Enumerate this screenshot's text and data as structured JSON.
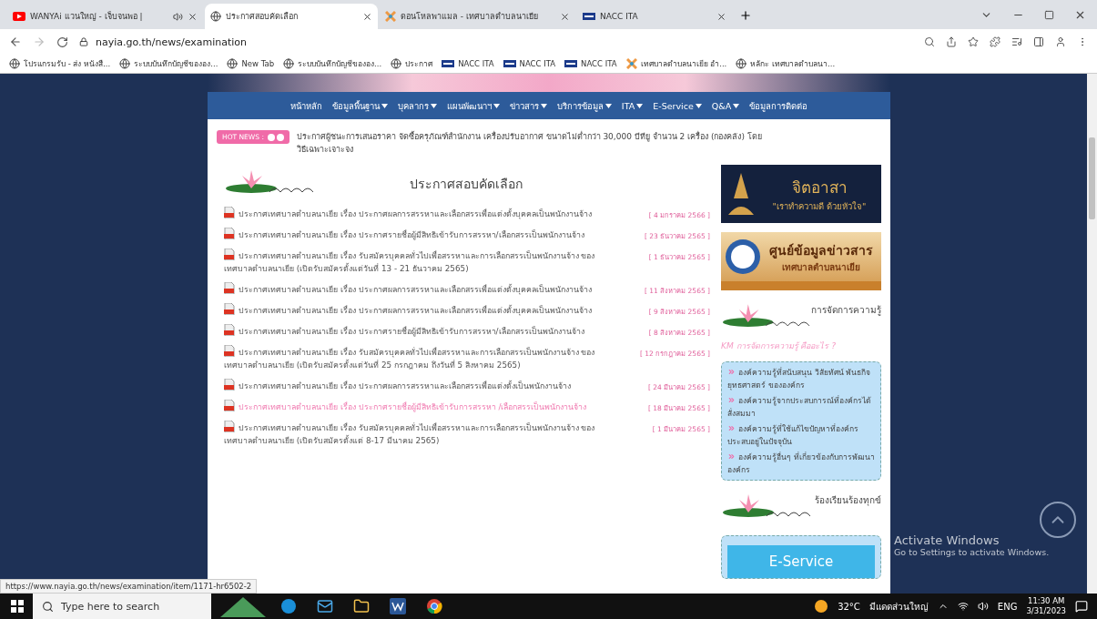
{
  "browser": {
    "tabs": [
      {
        "title": "WANYAi แวนใหญ่ - เจ็บจนพอ |",
        "selected": false,
        "audio": true,
        "kind": "video"
      },
      {
        "title": "ประกาศสอบคัดเลือก",
        "selected": true,
        "audio": false,
        "kind": "globe"
      },
      {
        "title": "ดอนโหลพาแมล - เทศบาลตำบลนาเยีย",
        "selected": false,
        "audio": false,
        "kind": "flag"
      },
      {
        "title": "NACC ITA",
        "selected": false,
        "audio": false,
        "kind": "ita"
      }
    ],
    "address": "nayia.go.th/news/examination",
    "bookmarks": [
      {
        "label": "โปรแกรมรับ - ส่ง หนังสื...",
        "kind": "globe"
      },
      {
        "label": "ระบบบันทึกบัญชีขององ...",
        "kind": "globe"
      },
      {
        "label": "New Tab",
        "kind": "globe"
      },
      {
        "label": "ระบบบันทึกบัญชีขององ...",
        "kind": "globe"
      },
      {
        "label": "ประกาศ",
        "kind": "globe"
      },
      {
        "label": "NACC ITA",
        "kind": "ita"
      },
      {
        "label": "NACC ITA",
        "kind": "ita"
      },
      {
        "label": "NACC ITA",
        "kind": "ita"
      },
      {
        "label": "เทศบาลตำบลนาเยีย อำ...",
        "kind": "flag"
      },
      {
        "label": "หลักะ เทศบาลตำบลนา...",
        "kind": "globe"
      }
    ]
  },
  "nav": [
    {
      "label": "หน้าหลัก",
      "dropdown": false
    },
    {
      "label": "ข้อมูลพื้นฐาน",
      "dropdown": true
    },
    {
      "label": "บุคลากร",
      "dropdown": true
    },
    {
      "label": "แผนพัฒนาฯ",
      "dropdown": true
    },
    {
      "label": "ข่าวสาร",
      "dropdown": true
    },
    {
      "label": "บริการข้อมูล",
      "dropdown": true
    },
    {
      "label": "ITA",
      "dropdown": true
    },
    {
      "label": "E-Service",
      "dropdown": true
    },
    {
      "label": "Q&A",
      "dropdown": true
    },
    {
      "label": "ข้อมูลการติดต่อ",
      "dropdown": false
    }
  ],
  "hot_news": {
    "badge": "HOT NEWS :",
    "text": "ประกาศผู้ชนะการเสนอราคา จัดซื้อครุภัณฑ์สำนักงาน เครื่องปรับอากาศ ขนาดไม่ต่ำกว่า 30,000 บีทียู จำนวน 2 เครื่อง (กองคลัง) โดยวิธีเฉพาะเจาะจง"
  },
  "section_title": "ประกาศสอบคัดเลือก",
  "announcements": [
    {
      "text": "ประกาศเทศบาลตำบลนาเยีย เรื่อง ประกาศผลการสรรหาและเลือกสรรเพื่อแต่งตั้งบุคคลเป็นพนักงานจ้าง",
      "date": "[ 4 มกราคม 2566 ]",
      "visited": false
    },
    {
      "text": "ประกาศเทศบาลตำบลนาเยีย เรื่อง ประกาศรายชื่อผู้มีสิทธิเข้ารับการสรรหา/เลือกสรรเป็นพนักงานจ้าง",
      "date": "[ 23 ธันวาคม 2565 ]",
      "visited": false
    },
    {
      "text": "ประกาศเทศบาลตำบลนาเยีย เรื่อง รับสมัครบุคคลทั่วไปเพื่อสรรหาและการเลือกสรรเป็นพนักงานจ้าง ของเทศบาลตำบลนาเยีย (เปิดรับสมัครตั้งแต่วันที่ 13 - 21 ธันวาคม 2565)",
      "date": "[ 1 ธันวาคม 2565 ]",
      "visited": false
    },
    {
      "text": "ประกาศเทศบาลตำบลนาเยีย เรื่อง ประกาศผลการสรรหาและเลือกสรรเพื่อแต่งตั้งบุคคลเป็นพนักงานจ้าง",
      "date": "[ 11 สิงหาคม 2565 ]",
      "visited": false
    },
    {
      "text": "ประกาศเทศบาลตำบลนาเยีย เรื่อง ประกาศผลการสรรหาและเลือกสรรเพื่อแต่งตั้งบุคคลเป็นพนักงานจ้าง",
      "date": "[ 9 สิงหาคม 2565 ]",
      "visited": false
    },
    {
      "text": "ประกาศเทศบาลตำบลนาเยีย เรื่อง ประกาศรายชื่อผู้มีสิทธิเข้ารับการสรรหา/เลือกสรรเป็นพนักงานจ้าง",
      "date": "[ 8 สิงหาคม 2565 ]",
      "visited": false
    },
    {
      "text": "ประกาศเทศบาลตำบลนาเยีย เรื่อง รับสมัครบุคคลทั่วไปเพื่อสรรหาและการเลือกสรรเป็นพนักงานจ้าง ของเทศบาลตำบลนาเยีย (เปิดรับสมัครตั้งแต่วันที่ 25 กรกฎาคม ถึงวันที่ 5 สิงหาคม 2565)",
      "date": "[ 12 กรกฎาคม 2565 ]",
      "visited": false
    },
    {
      "text": "ประกาศเทศบาลตำบลนาเยีย เรื่อง ประกาศผลการสรรหาและเลือกสรรเพื่อแต่งตั้งเป็นพนักงานจ้าง",
      "date": "[ 24 มีนาคม 2565 ]",
      "visited": false
    },
    {
      "text": "ประกาศเทศบาลตำบลนาเยีย เรื่อง ประกาศรายชื่อผู้มีสิทธิเข้ารับการสรรหา /เลือกสรรเป็นพนักงานจ้าง",
      "date": "[ 18 มีนาคม 2565 ]",
      "visited": true
    },
    {
      "text": "ประกาศเทศบาลตำบลนาเยีย เรื่อง รับสมัครบุคคลทั่วไปเพื่อสรรหาและการเลือกสรรเป็นพนักงานจ้าง ของเทศบาลตำบลนาเยีย (เปิดรับสมัครตั้งแต่ 8-17 มีนาคม 2565)",
      "date": "[ 1 มีนาคม 2565 ]",
      "visited": false
    }
  ],
  "sidebar": {
    "banner_jitasa": {
      "title": "จิตอาสา",
      "slogan": "\"เราทำความดี ด้วยหัวใจ\""
    },
    "banner_info": {
      "title": "ศูนย์ข้อมูลข่าวสาร",
      "subtitle": "เทศบาลตำบลนาเยีย"
    },
    "km": {
      "heading": "การจัดการความรู้",
      "link": "KM การจัดการความรู้ คืออะไร ?",
      "items": [
        "องค์ความรู้ที่สนับสนุน วิสัยทัศน์ พันธกิจ ยุทธศาสตร์ ขององค์กร",
        "องค์ความรู้จากประสบการณ์ที่องค์กรได้สั่งสมมา",
        "องค์ความรู้ที่ใช้แก้ไขปัญหาที่องค์กรประสบอยู่ในปัจจุบัน",
        "องค์ความรู้อื่นๆ ที่เกี่ยวข้องกับการพัฒนาองค์กร"
      ]
    },
    "complaints": {
      "heading": "ร้องเรียนร้องทุกข์",
      "button": "E-Service"
    }
  },
  "status_url": "https://www.nayia.go.th/news/examination/item/1171-hr6502-2",
  "activation": {
    "title": "Activate Windows",
    "subtitle": "Go to Settings to activate Windows."
  },
  "taskbar": {
    "search": "Type here to search",
    "temperature": "32°C",
    "weather": "มีแดดส่วนใหญ่",
    "language": "ENG",
    "time": "11:30 AM",
    "date": "3/31/2023"
  }
}
